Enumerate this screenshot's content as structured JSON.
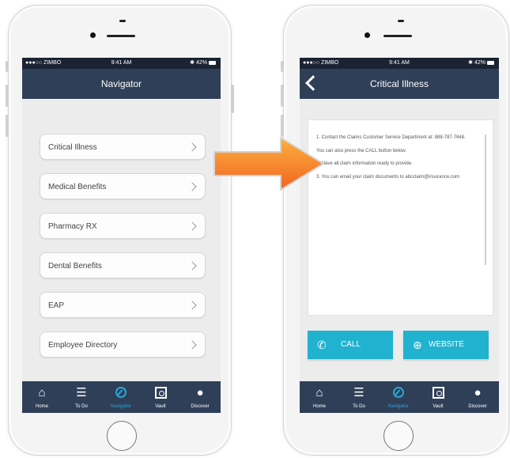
{
  "left_phone": {
    "status": {
      "carrier": "●●●○○ ZIMBO",
      "time": "9:41 AM",
      "battery": "42%"
    },
    "title": "Navigator",
    "menu": [
      {
        "label": "Critical Illness"
      },
      {
        "label": "Medical Benefits"
      },
      {
        "label": "Pharmacy RX"
      },
      {
        "label": "Dental Benefits"
      },
      {
        "label": "EAP"
      },
      {
        "label": "Employee Directory"
      }
    ],
    "tabs": [
      {
        "label": "Home",
        "icon": "home-icon"
      },
      {
        "label": "To Do",
        "icon": "checklist-icon"
      },
      {
        "label": "Navigator",
        "icon": "compass-icon",
        "active": true
      },
      {
        "label": "Vault",
        "icon": "vault-icon"
      },
      {
        "label": "Discover",
        "icon": "discover-icon"
      }
    ]
  },
  "right_phone": {
    "status": {
      "carrier": "●●●○○ ZIMBO",
      "time": "9:41 AM",
      "battery": "42%"
    },
    "title": "Critical Illness",
    "content": {
      "line1": "1. Contact the  Claims Customer Service Department at: 888-787-7648.",
      "line2": "You can also press the CALL button below.",
      "line3": "2. Have all claim information ready to provide.",
      "line4": "3. You can email your claim documents to abcclaim@insurance.com"
    },
    "buttons": {
      "call": "CALL",
      "website": "WEBSITE"
    },
    "tabs": [
      {
        "label": "Home",
        "icon": "home-icon"
      },
      {
        "label": "To Do",
        "icon": "checklist-icon"
      },
      {
        "label": "Navigator",
        "icon": "compass-icon",
        "active": true
      },
      {
        "label": "Vault",
        "icon": "vault-icon"
      },
      {
        "label": "Discover",
        "icon": "discover-icon"
      }
    ]
  },
  "colors": {
    "navbar": "#2f3f58",
    "statusbar": "#1b2333",
    "accent": "#2ba6d6",
    "button": "#21b2d0",
    "arrow": "#f7941d"
  }
}
